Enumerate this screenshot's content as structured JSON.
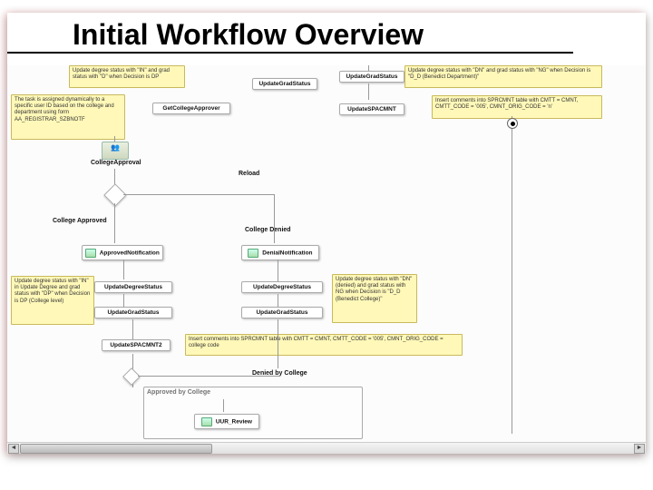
{
  "title": "Initial Workflow Overview",
  "notes": {
    "n1": "Update degree status with \"IN\" and grad status with \"D\" when Decision is DP",
    "n2": "The task is assigned dynamically to a specific user ID based on the college and department using form AA_REGISTRAR_SZBNOTF",
    "n3": "Update degree status with \"DN\" and grad status with \"NG\" when Decision is \"D_D (Benedict Department)\"",
    "n4": "Insert comments into SPRCMNT table with CMTT = CMNT, CMTT_CODE = '005', CMNT_ORIG_CODE = 'n'",
    "n5": "Update degree status with \"IN\" in Update Degree and grad status with \"DP\" when Decision is DP (College level)",
    "n6": "Update degree status with \"DN\" (denied) and grad status with NG when Decision is \"D_D (Benedict College)\"",
    "n7": "Insert comments into SPRCMNT table with CMTT = CMNT, CMTT_CODE = '005', CMNT_ORIG_CODE = college code"
  },
  "nodes": {
    "updateGradStatus1": "UpdateGradStatus",
    "updateGradStatus2": "UpdateGradStatus",
    "getCollegeApprover": "GetCollegeApprover",
    "collegeApproval": "CollegeApproval",
    "updateSPACMNT": "UpdateSPACMNT",
    "reload": "Reload",
    "approvedNotification": "ApprovedNotification",
    "denialNotification": "DenialNotification",
    "updateDegreeStatusL": "UpdateDegreeStatus",
    "updateGradStatusL": "UpdateGradStatus",
    "updateDegreeStatusR": "UpdateDegreeStatus",
    "updateGradStatusR": "UpdateGradStatus",
    "updateSPACMNT2": "UpdateSPACMNT2",
    "uurReview": "UUR_Review"
  },
  "labels": {
    "collegeApproved": "College Approved",
    "collegeDenied": "College Denied",
    "deniedByCollege": "Denied by College",
    "approvedByCollege": "Approved by College"
  }
}
